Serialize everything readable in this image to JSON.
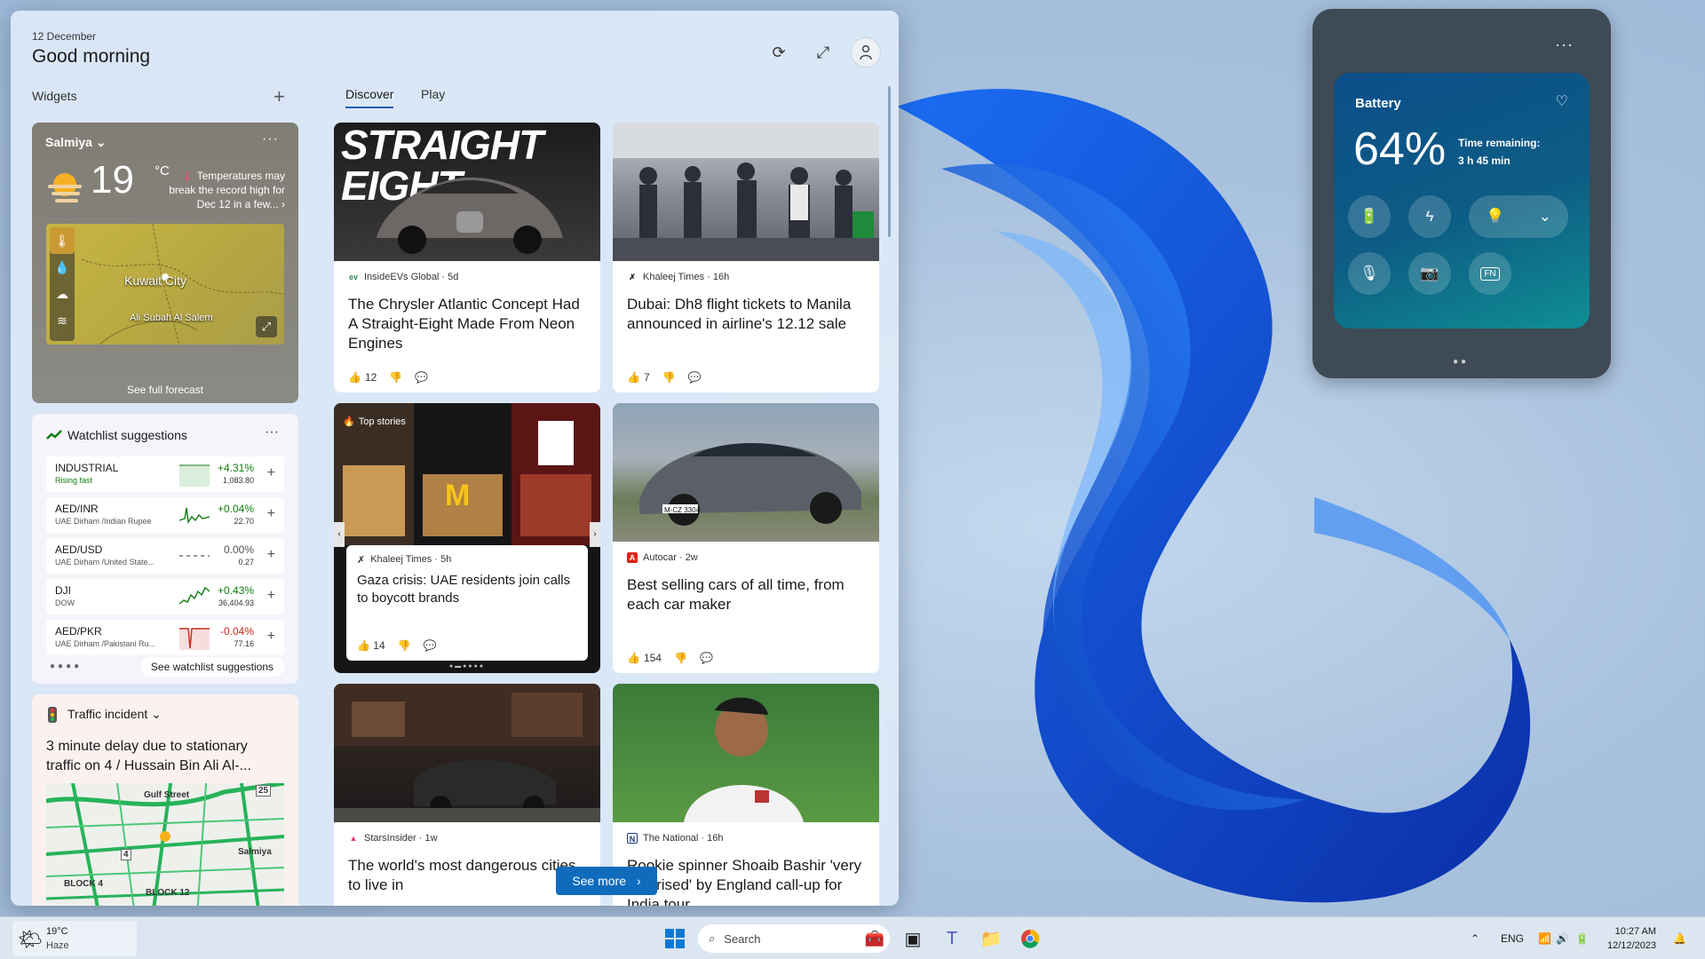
{
  "panel": {
    "date": "12 December",
    "greeting": "Good morning",
    "widgets_label": "Widgets",
    "add_widget": "+",
    "tabs": [
      {
        "label": "Discover"
      },
      {
        "label": "Play"
      }
    ],
    "refresh_icon": "refresh-icon",
    "expand_icon": "expand-icon",
    "avatar_icon": "avatar-icon"
  },
  "weather": {
    "location": "Salmiya",
    "temp": "19",
    "unit": "°C",
    "alert": "Temperatures may break the record high for Dec 12 in a few...",
    "map_city": "Kuwait City",
    "map_city2": "Ali Subah Al Salem",
    "forecast_link": "See full forecast"
  },
  "watchlist": {
    "title": "Watchlist suggestions",
    "rows": [
      {
        "symbol": "INDUSTRIAL",
        "sub": "Rising fast",
        "change": "+4.31%",
        "value": "1,083.80",
        "dir": "up"
      },
      {
        "symbol": "AED/INR",
        "sub": "UAE Dirham /Indian Rupee",
        "change": "+0.04%",
        "value": "22.70",
        "dir": "up"
      },
      {
        "symbol": "AED/USD",
        "sub": "UAE Dirham /United State...",
        "change": "0.00%",
        "value": "0.27",
        "dir": "flat"
      },
      {
        "symbol": "DJI",
        "sub": "DOW",
        "change": "+0.43%",
        "value": "36,404.93",
        "dir": "up"
      },
      {
        "symbol": "AED/PKR",
        "sub": "UAE Dirham /Pakistani Ru...",
        "change": "-0.04%",
        "value": "77.16",
        "dir": "dn"
      }
    ],
    "link": "See watchlist suggestions"
  },
  "traffic": {
    "title": "Traffic incident",
    "text": "3 minute delay due to stationary traffic on 4 / Hussain Bin Ali Al-...",
    "labels": [
      "Gulf Street",
      "Salmiya",
      "BLOCK 4",
      "BLOCK 12",
      "25",
      "4"
    ]
  },
  "news": [
    {
      "source": "InsideEVs Global · 5d",
      "title": "The Chrysler Atlantic Concept Had A Straight-Eight Made From Neon Engines",
      "likes": "12",
      "img_text": "STRAIGHT EIGHT"
    },
    {
      "source": "Khaleej Times · 16h",
      "title": "Dubai: Dh8 flight tickets to Manila announced in airline's 12.12 sale",
      "likes": "7"
    },
    {
      "source": "Khaleej Times · 5h",
      "title": "Gaza crisis: UAE residents join calls to boycott brands",
      "likes": "14",
      "badge": "Top stories"
    },
    {
      "source": "Autocar · 2w",
      "title": "Best selling cars of all time, from each car maker",
      "likes": "154",
      "plate": "M-CZ 3304"
    },
    {
      "source": "StarsInsider · 1w",
      "title": "The world's most dangerous cities to live in"
    },
    {
      "source": "The National · 16h",
      "title": "Rookie spinner Shoaib Bashir 'very surprised' by England call-up for India tour"
    }
  ],
  "see_more": "See more",
  "battery": {
    "title": "Battery",
    "percent": "64%",
    "level": 0.64,
    "time_label": "Time remaining:",
    "time_value": "3 h 45 min",
    "fn_label": "FN"
  },
  "taskbar": {
    "weather_temp": "19°C",
    "weather_cond": "Haze",
    "search_placeholder": "Search",
    "lang": "ENG",
    "time": "10:27 AM",
    "date": "12/12/2023"
  },
  "colors": {
    "accent": "#0f6cbd",
    "up": "#107c10",
    "down": "#c42b1c"
  }
}
